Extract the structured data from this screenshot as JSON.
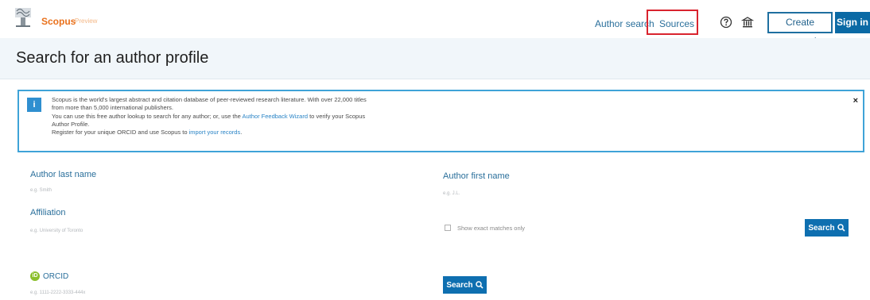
{
  "header": {
    "logo_text": "Scopus",
    "logo_subtitle": "Preview",
    "nav": {
      "author_search": "Author search",
      "sources": "Sources"
    },
    "create_account": "Create account",
    "sign_in": "Sign in",
    "icons": [
      "help-icon",
      "institution-icon"
    ]
  },
  "page": {
    "title": "Search for an author profile"
  },
  "banner": {
    "badge": "i",
    "line1": "Scopus is the world's largest abstract and citation database of peer-reviewed research literature. With over 22,000 titles",
    "line2": "from more than 5,000 international publishers.",
    "line3_pre": "You can use this free author lookup to search for any author; or, use the ",
    "line3_link": "Author Feedback Wizard",
    "line3_post": " to verify your Scopus",
    "line4": "Author Profile.",
    "line5_pre": "Register for your unique ORCID and use Scopus to ",
    "line5_link": "import your records",
    "line5_post": ".",
    "close": "×"
  },
  "form": {
    "last_name_label": "Author last name",
    "last_name_placeholder": "e.g. Smith",
    "first_name_label": "Author first name",
    "first_name_placeholder": "e.g. J.L.",
    "affiliation_label": "Affiliation",
    "affiliation_placeholder": "e.g. University of Toronto",
    "exact_matches": "Show exact matches only",
    "search_label": "Search",
    "orcid_label": "ORCID",
    "orcid_badge": "iD",
    "orcid_placeholder": "e.g. 1111-2222-3333-444x"
  },
  "colors": {
    "brand_orange": "#e9711c",
    "link_blue": "#2a6f9b",
    "button_blue": "#0e6fb0",
    "highlight_red": "#d9232e"
  }
}
